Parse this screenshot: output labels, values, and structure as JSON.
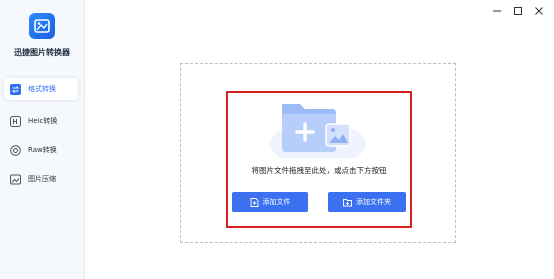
{
  "app": {
    "title": "迅捷图片转换器"
  },
  "sidebar": {
    "items": [
      {
        "label": "格式转换",
        "icon": "swap-icon"
      },
      {
        "label": "Heic转换",
        "icon": "heic-icon"
      },
      {
        "label": "Raw转换",
        "icon": "raw-icon"
      },
      {
        "label": "图片压缩",
        "icon": "image-compress-icon"
      }
    ]
  },
  "main": {
    "hint": "将图片文件拖拽至此处，或点击下方按钮",
    "add_file_label": "添加文件",
    "add_folder_label": "添加文件夹"
  },
  "colors": {
    "accent": "#3b71f0",
    "highlight": "#d61f1f",
    "sidebar_bg": "#f5f8fd"
  }
}
